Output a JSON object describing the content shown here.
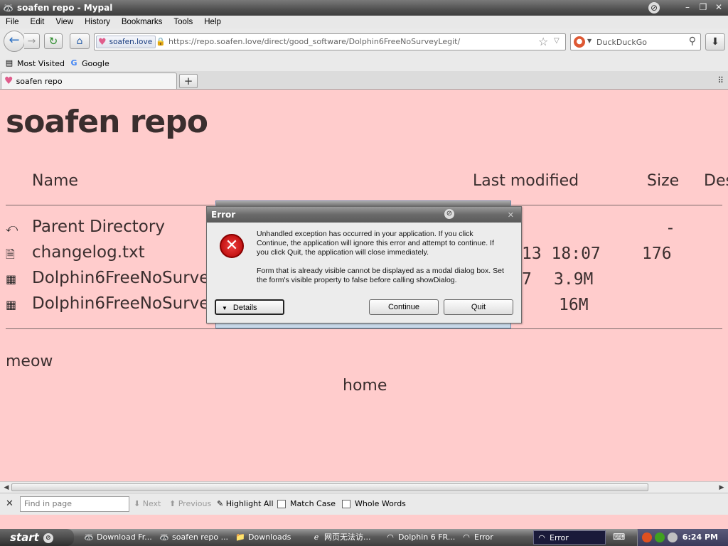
{
  "window": {
    "title": "soafen repo - Mypal"
  },
  "menu": [
    "File",
    "Edit",
    "View",
    "History",
    "Bookmarks",
    "Tools",
    "Help"
  ],
  "nav": {
    "identity": "soafen.love",
    "url": "https://repo.soafen.love/direct/good_software/Dolphin6FreeNoSurveyLegit/",
    "search_placeholder": "DuckDuckGo"
  },
  "bookmarks": [
    {
      "label": "Most Visited",
      "icon": "bookmark-folder-icon"
    },
    {
      "label": "Google",
      "icon": "google-icon"
    }
  ],
  "tabs": [
    {
      "label": "soafen repo"
    }
  ],
  "page": {
    "heading": "soafen repo",
    "columns": {
      "name": "Name",
      "modified": "Last modified",
      "size": "Size",
      "description": "Des"
    },
    "rows": [
      {
        "name": "Parent Directory",
        "modified": "",
        "size": "-",
        "icon": "parent-dir-icon"
      },
      {
        "name": "changelog.txt",
        "modified": "13 18:07",
        "size": "176",
        "icon": "text-file-icon"
      },
      {
        "name": "Dolphin6FreeNoSurveyL",
        "modified": "7",
        "size": "3.9M",
        "icon": "binary-file-icon"
      },
      {
        "name": "Dolphin6FreeNoSurveyL",
        "modified": "",
        "size": "16M",
        "icon": "binary-file-icon"
      }
    ],
    "footer_text": "meow",
    "home_link": "home"
  },
  "findbar": {
    "placeholder": "Find in page",
    "next": "Next",
    "previous": "Previous",
    "highlight_all": "Highlight All",
    "match_case": "Match Case",
    "whole_words": "Whole Words"
  },
  "dialog": {
    "title": "Error",
    "message1": "Unhandled exception has occurred in your application. If you click Continue, the application will ignore this error and attempt to continue. If you click Quit, the application will close immediately.",
    "message2": "Form that is already visible cannot be displayed as a modal dialog box. Set the form's visible property to false before calling showDialog.",
    "details": "Details",
    "continue": "Continue",
    "quit": "Quit"
  },
  "taskbar": {
    "start": "start",
    "tasks": [
      {
        "label": "Download Fr...",
        "active": false
      },
      {
        "label": "soafen repo ...",
        "active": false
      },
      {
        "label": "Downloads",
        "active": false
      },
      {
        "label": "网页无法访...",
        "active": false
      },
      {
        "label": "Dolphin 6 FR...",
        "active": false
      },
      {
        "label": "Error",
        "active": false
      },
      {
        "label": "Error",
        "active": true
      }
    ],
    "clock": "6:24 PM"
  },
  "colors": {
    "page_bg": "#ffcccc",
    "error_red": "#cc0000",
    "link_blue": "#1a3d80"
  }
}
